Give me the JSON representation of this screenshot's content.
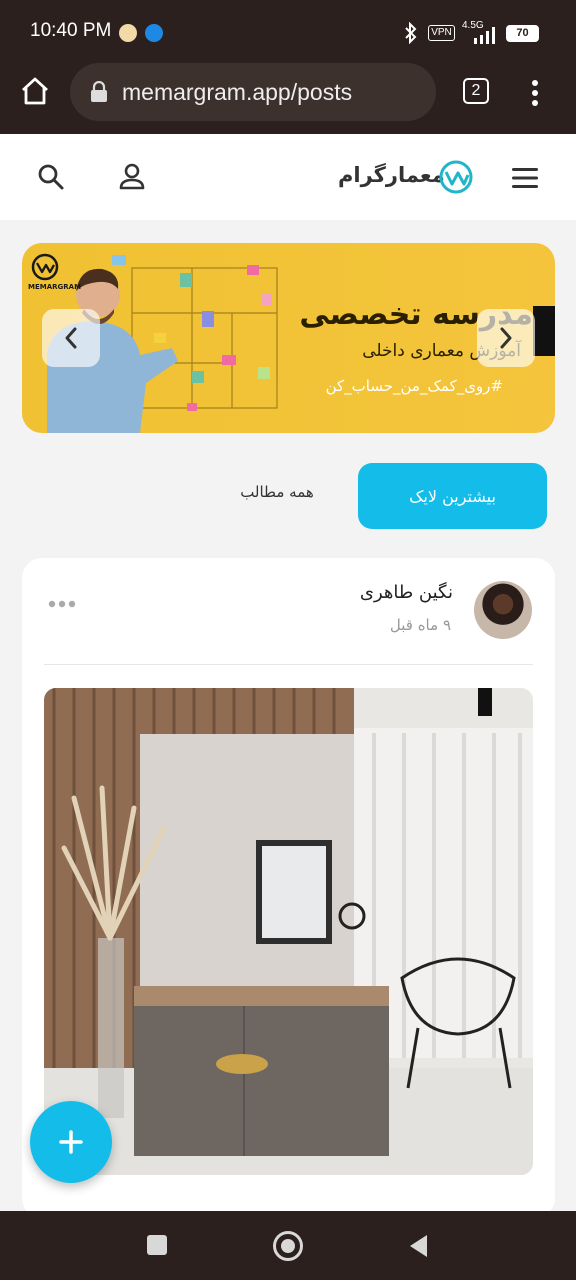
{
  "status_bar": {
    "time": "10:40 PM",
    "vpn": "VPN",
    "network": "4.5G",
    "battery": "70"
  },
  "browser": {
    "url": "memargram.app/posts",
    "tab_count": "2"
  },
  "app": {
    "brand": "معمارگرام"
  },
  "banner": {
    "logo_text": "MEMARGRAM",
    "title": "مدرسه تخصصی",
    "subtitle": "آموزش معماری داخلی",
    "hashtag": "#روی_کمک_من_حساب_کن"
  },
  "tabs": {
    "most_liked": "بیشترین لایک",
    "all_posts": "همه مطالب"
  },
  "post": {
    "author": "نگین طاهری",
    "time": "۹ ماه قبل"
  },
  "colors": {
    "accent": "#14bde9",
    "browser_chrome": "#2b201d",
    "banner": "#f2c339"
  }
}
